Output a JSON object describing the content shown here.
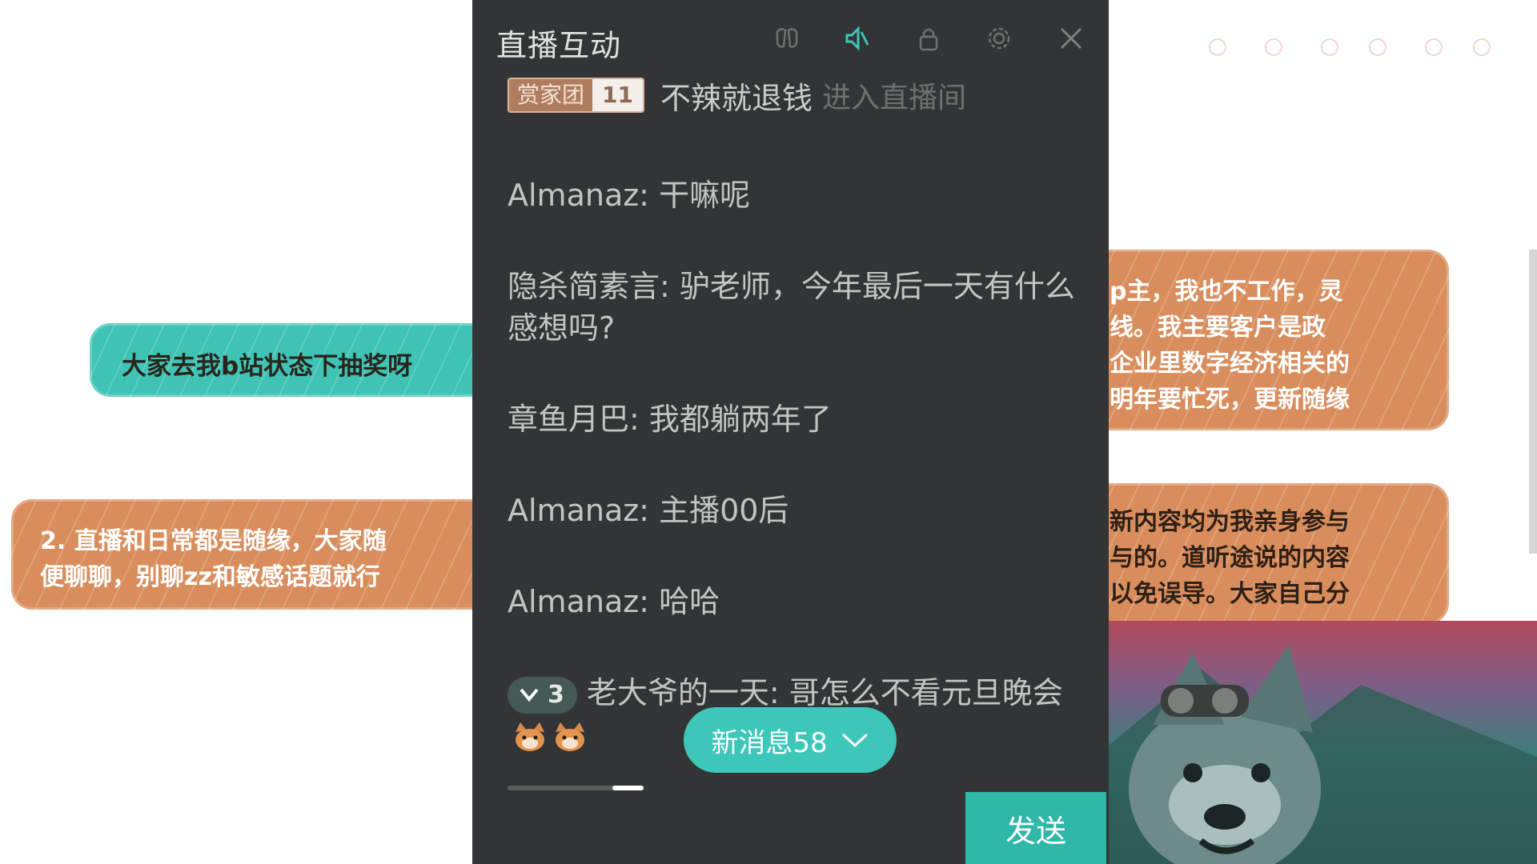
{
  "panel": {
    "title": "直播互动",
    "icons": [
      "filter-icon",
      "mute-icon",
      "lock-icon",
      "gear-icon",
      "close-icon"
    ]
  },
  "enter_notice": {
    "badge_name": "赏家团",
    "badge_level": "11",
    "user": "不辣就退钱",
    "tip": "进入直播间"
  },
  "messages": [
    {
      "user": "Almanaz",
      "text": "干嘛呢"
    },
    {
      "user": "隐杀简素言",
      "text": "驴老师，今年最后一天有什么感想吗?"
    },
    {
      "user": "章鱼月巴",
      "text": "我都躺两年了"
    },
    {
      "user": "Almanaz",
      "text": "主播00后"
    },
    {
      "user": "Almanaz",
      "text": "哈哈"
    },
    {
      "user": "老大爷的一天",
      "text": "哥怎么不看元旦晚会",
      "rank": "3",
      "emojis": 2
    }
  ],
  "new_messages": {
    "label": "新消息58"
  },
  "send": {
    "label": "发送"
  },
  "input": {
    "progress": 0.23
  },
  "scene": {
    "lottery": "大家去我b站状态下抽奖呀",
    "rules": [
      "2. 直播和日常都是随缘，大家随",
      "便聊聊，别聊zz和敏感话题就行"
    ],
    "intro": [
      "p主，我也不工作，灵",
      "线。我主要客户是政",
      "企业里数字经济相关的",
      "明年要忙死，更新随缘"
    ],
    "content": [
      "新内容均为我亲身参与",
      "与的。道听途说的内容",
      "以免误导。大家自己分"
    ]
  },
  "colors": {
    "panel_bg": "#333436",
    "accent": "#3cc7b8",
    "note_teal": "#3ec3b4",
    "note_orange": "#d98d5c"
  }
}
